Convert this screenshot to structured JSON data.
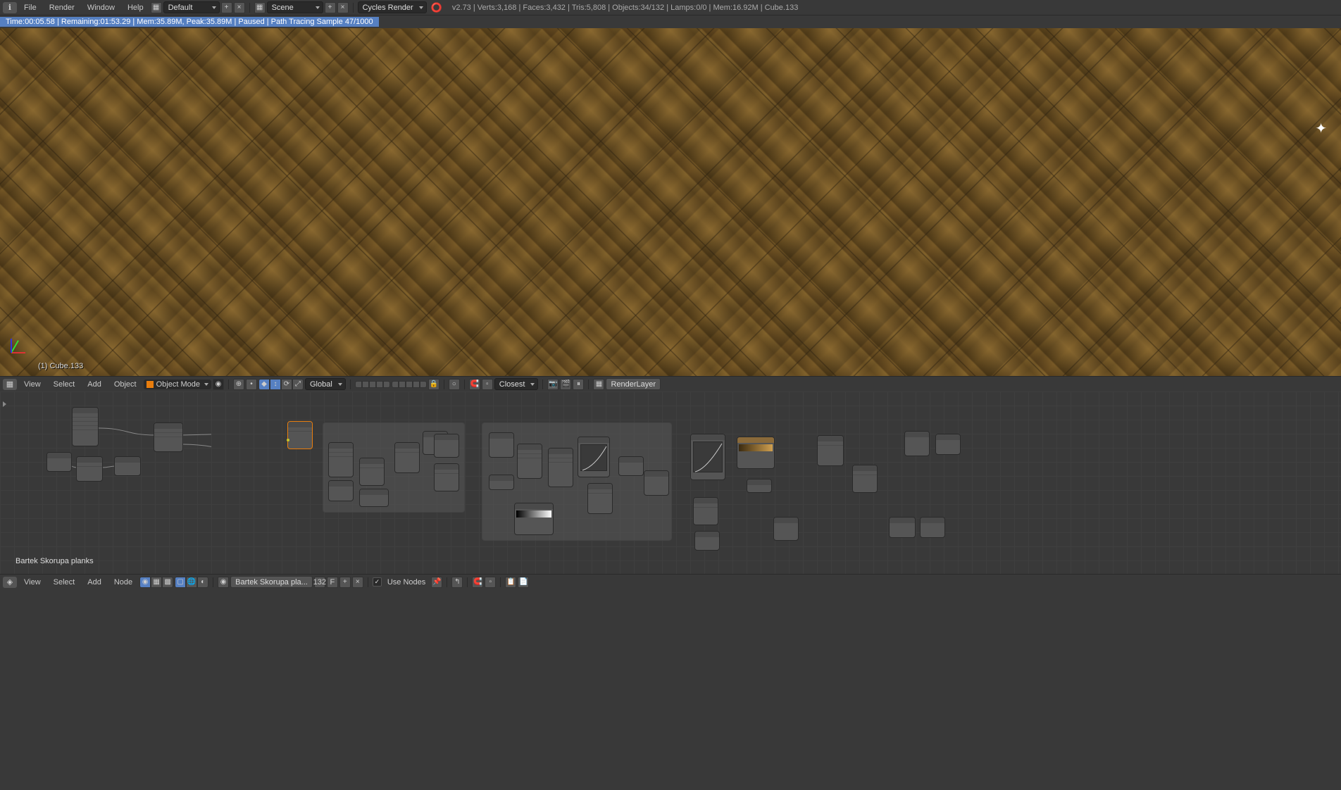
{
  "topbar": {
    "menus": [
      "File",
      "Render",
      "Window",
      "Help"
    ],
    "layout_label": "Default",
    "scene_label": "Scene",
    "engine": "Cycles Render",
    "stats": "v2.73 | Verts:3,168 | Faces:3,432 | Tris:5,808 | Objects:34/132 | Lamps:0/0 | Mem:16.92M | Cube.133"
  },
  "render_status": "Time:00:05.58 | Remaining:01:53.29 | Mem:35.89M, Peak:35.89M | Paused | Path Tracing Sample 47/1000",
  "viewport": {
    "active_object": "(1) Cube.133"
  },
  "toolbar3d": {
    "menus": [
      "View",
      "Select",
      "Add",
      "Object"
    ],
    "mode": "Object Mode",
    "orientation": "Global",
    "snap_target": "Closest",
    "render_layer": "RenderLayer"
  },
  "node_editor": {
    "material_name": "Bartek Skorupa planks"
  },
  "toolbar_ne": {
    "menus": [
      "View",
      "Select",
      "Add",
      "Node"
    ],
    "material": "Bartek Skorupa pla...",
    "users": "132",
    "fake": "F",
    "use_nodes": "Use Nodes"
  }
}
